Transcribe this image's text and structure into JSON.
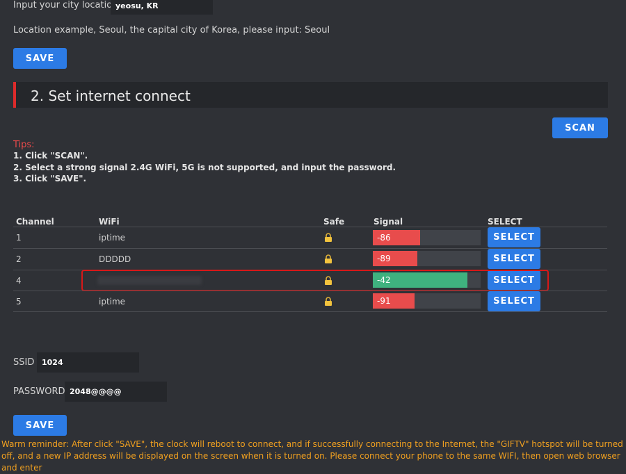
{
  "city": {
    "label": "Input your city location:",
    "value": "yeosu, KR",
    "example": "Location example, Seoul, the capital city of Korea, please input: Seoul",
    "save_label": "SAVE"
  },
  "section": {
    "title": "2. Set internet connect"
  },
  "scan_label": "SCAN",
  "tips": {
    "title": "Tips:",
    "items": [
      "1. Click \"SCAN\".",
      "2. Select a strong signal 2.4G WiFi, 5G is not supported, and input the password.",
      "3. Click \"SAVE\"."
    ]
  },
  "table": {
    "headers": [
      "Channel",
      "WiFi",
      "Safe",
      "Signal",
      "SELECT"
    ],
    "select_label": "SELECT",
    "rows": [
      {
        "channel": "1",
        "wifi": "iptime",
        "signal": "-86",
        "level": 0.44,
        "color": "#e84c4c"
      },
      {
        "channel": "2",
        "wifi": "DDDDD",
        "signal": "-89",
        "level": 0.41,
        "color": "#e84c4c"
      },
      {
        "channel": "4",
        "wifi": "",
        "signal": "-42",
        "level": 0.88,
        "color": "#3fb27f",
        "highlighted": true
      },
      {
        "channel": "5",
        "wifi": "iptime",
        "signal": "-91",
        "level": 0.39,
        "color": "#e84c4c"
      }
    ]
  },
  "ssid": {
    "label": "SSID :",
    "value": "1024"
  },
  "password": {
    "label": "PASSWORD :",
    "value": "2048@@@@"
  },
  "save_label": "SAVE",
  "warning": "Warm reminder: After click \"SAVE\", the clock will reboot to connect, and if successfully connecting to the Internet, the \"GIFTV\" hotspot will be turned off, and a new IP address will be displayed on the screen when it is turned on. Please connect your phone to the same WIFI, then open web browser and enter",
  "colors": {
    "accent": "#2c7be5",
    "section_mark": "#dd2b2b",
    "weak": "#e84c4c",
    "strong": "#3fb27f",
    "warning": "#f0a020"
  }
}
